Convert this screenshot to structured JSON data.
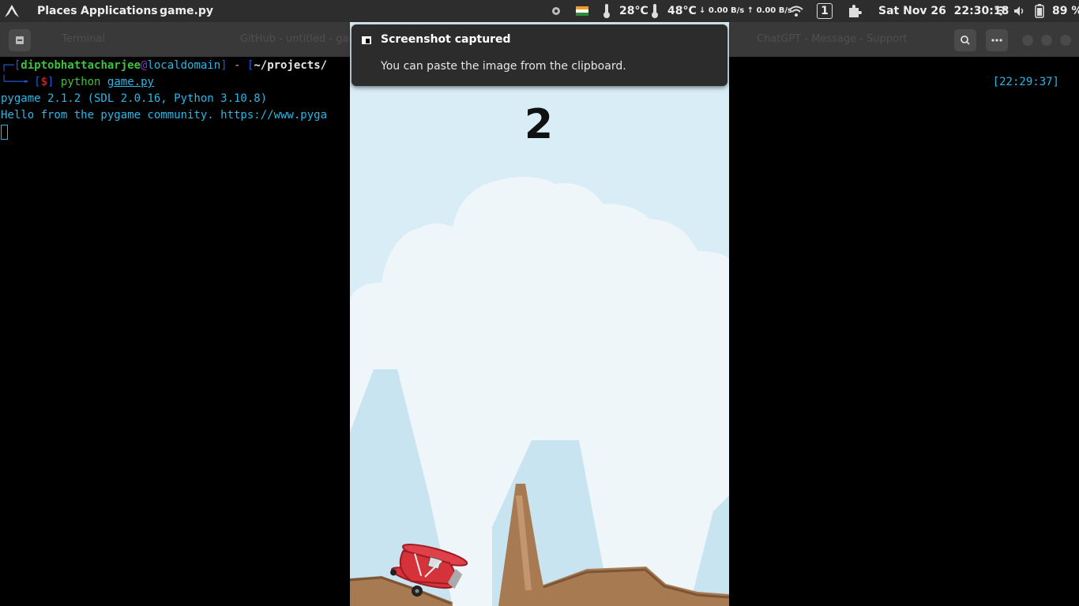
{
  "top_panel": {
    "places": "Places",
    "applications": "Applications",
    "active_app": "game.py",
    "cpu_temp": "28°C",
    "gpu_temp": "48°C",
    "net_speed": "↓ 0.00 B/s ↑ 0.00 B/s",
    "workspace": "1",
    "date": "Sat Nov 26",
    "time": "22:30:18",
    "battery": "89 %"
  },
  "terminal": {
    "user": "diptobhattacharjee",
    "at": "@",
    "host": "localdomain",
    "path": "~/projects/",
    "prompt": "$",
    "command": "python",
    "argument": "game.py",
    "timestamp": "[22:29:37]",
    "output_line1": "pygame 2.1.2 (SDL 2.0.16, Python 3.10.8)",
    "output_line2": "Hello from the pygame community. https://www.pyga"
  },
  "game": {
    "score": "2",
    "colors": {
      "sky": "#d8edf6",
      "plane": "#d6323a",
      "ground": "#a87a52"
    }
  },
  "notification": {
    "title": "Screenshot captured",
    "body": "You can paste the image from the clipboard."
  }
}
